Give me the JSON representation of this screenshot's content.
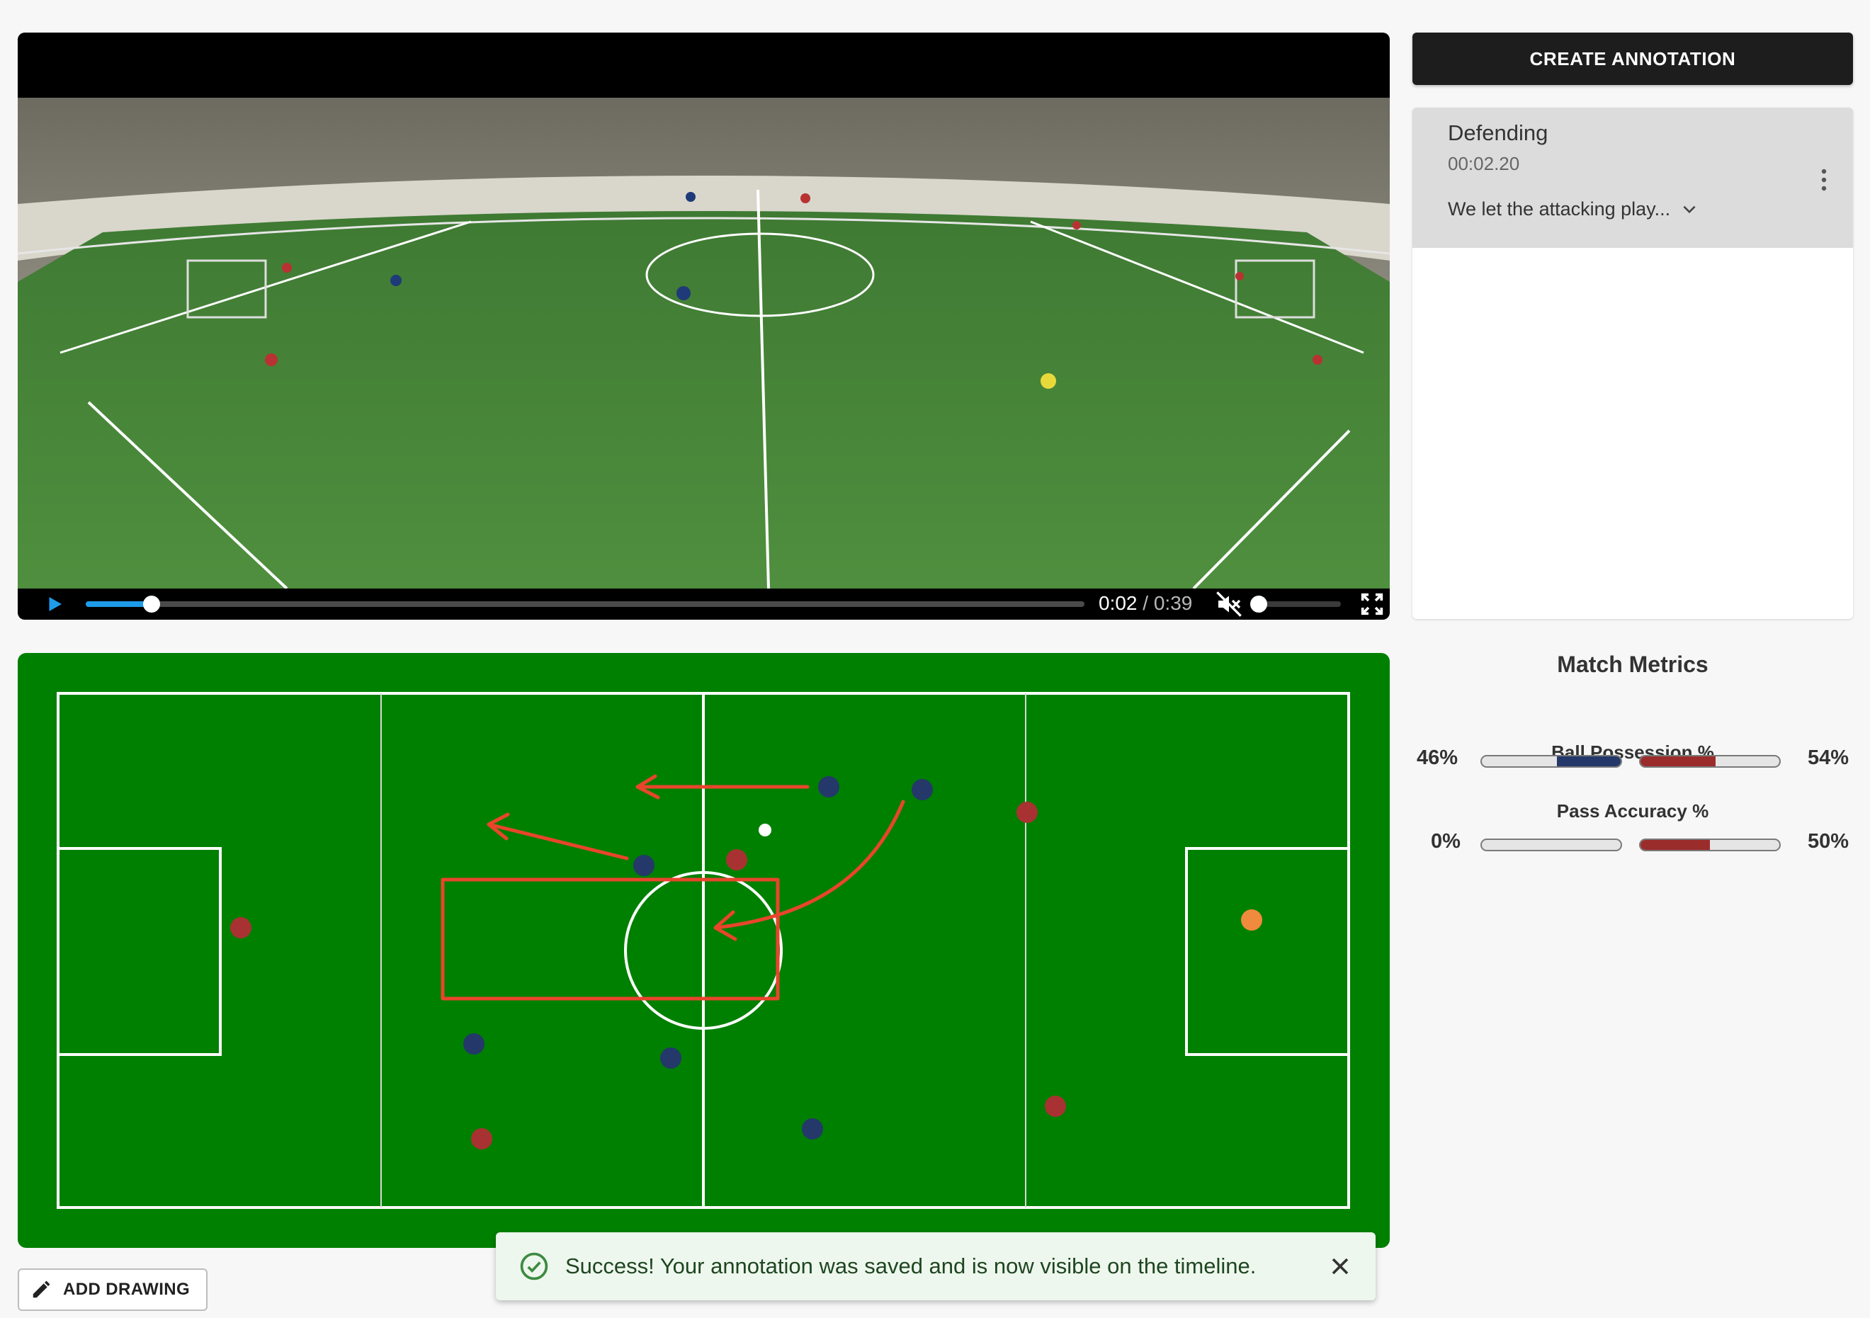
{
  "player": {
    "current_time": "0:02",
    "separator": " / ",
    "duration": "0:39",
    "progress": 0.066,
    "volume": 0.0,
    "muted": true,
    "accent_color": "#1e9be9"
  },
  "annotations": {
    "create_label": "CREATE ANNOTATION",
    "items": [
      {
        "title": "Defending",
        "timestamp": "00:02.20",
        "description": "We let the attacking play..."
      }
    ]
  },
  "metrics": {
    "title": "Match Metrics",
    "rows": [
      {
        "label": "Ball Possession %",
        "left_value": "46%",
        "right_value": "54%",
        "left_fill": 0.46,
        "right_fill": 0.54
      },
      {
        "label": "Pass Accuracy %",
        "left_value": "0%",
        "right_value": "50%",
        "left_fill": 0.0,
        "right_fill": 0.5
      }
    ],
    "team_colors": {
      "blue": "#24386a",
      "red": "#9b2c2c"
    }
  },
  "pitch": {
    "colors": {
      "grass": "#008000",
      "blue_team": "#24386a",
      "red_team": "#a83232",
      "goalkeeper": "#f08a3c",
      "ball": "#ffffff",
      "drawing": "#e8452c"
    }
  },
  "toolbar": {
    "add_drawing_label": "ADD DRAWING"
  },
  "toast": {
    "message": "Success! Your annotation was saved and is now visible on the timeline."
  },
  "icons": [
    "play-icon",
    "volume-muted-icon",
    "fullscreen-icon",
    "chevron-down-icon",
    "more-vert-icon",
    "pencil-icon",
    "check-circle-icon",
    "close-icon"
  ]
}
